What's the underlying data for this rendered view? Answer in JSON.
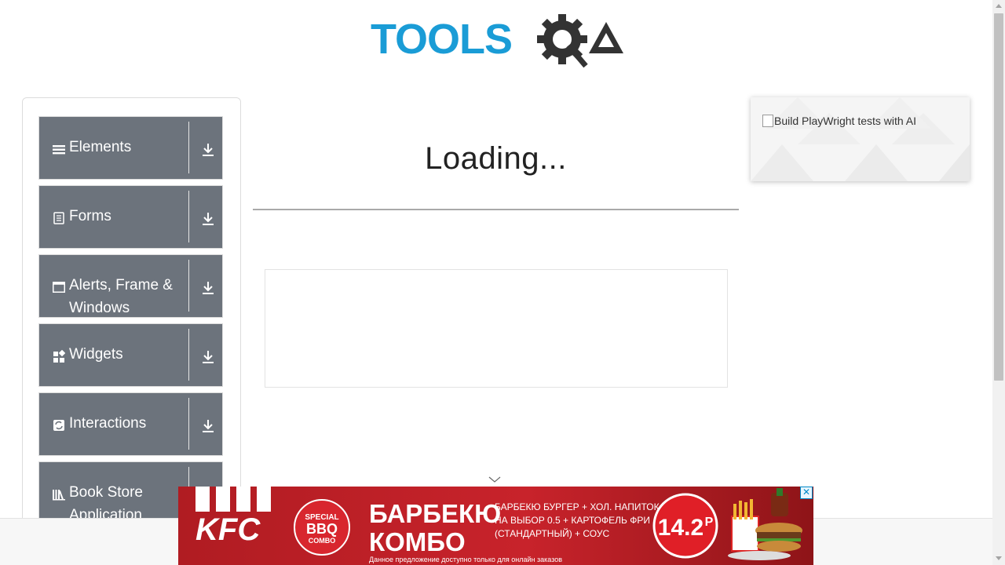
{
  "logo": {
    "part1": "TOOLS",
    "part2": "QA"
  },
  "sidebar": {
    "items": [
      {
        "label": "Elements",
        "icon": "hamburger-icon"
      },
      {
        "label": "Forms",
        "icon": "document-icon"
      },
      {
        "label": "Alerts, Frame & Windows",
        "icon": "window-icon"
      },
      {
        "label": "Widgets",
        "icon": "widgets-icon"
      },
      {
        "label": "Interactions",
        "icon": "interactions-icon"
      },
      {
        "label": "Book Store Application",
        "icon": "library-icon"
      }
    ]
  },
  "main": {
    "title": "Loading..."
  },
  "side_ad": {
    "alt_text": "Build PlayWright tests with AI"
  },
  "banner": {
    "brand": "KFC",
    "badge_line1": "SPECIAL",
    "badge_line2": "BBQ",
    "badge_line3": "COMBO",
    "headline1": "БАРБЕКЮ",
    "headline2": "КОМБО",
    "desc1": "БАРБЕКЮ БУРГЕР + ХОЛ. НАПИТОК",
    "desc2": "НА ВЫБОР 0.5 + КАРТОФЕЛЬ ФРИ",
    "desc3": "(СТАНДАРТНЫЙ) + СОУС",
    "price": "14.2",
    "currency": "Р",
    "footnote": "Данное предложение доступно только для онлайн заказов",
    "close": "✕"
  },
  "colors": {
    "sidebar_card": "#6c737c",
    "logo_blue": "#1a9cd6",
    "logo_dark": "#333333",
    "kfc_red": "#b81d24"
  }
}
